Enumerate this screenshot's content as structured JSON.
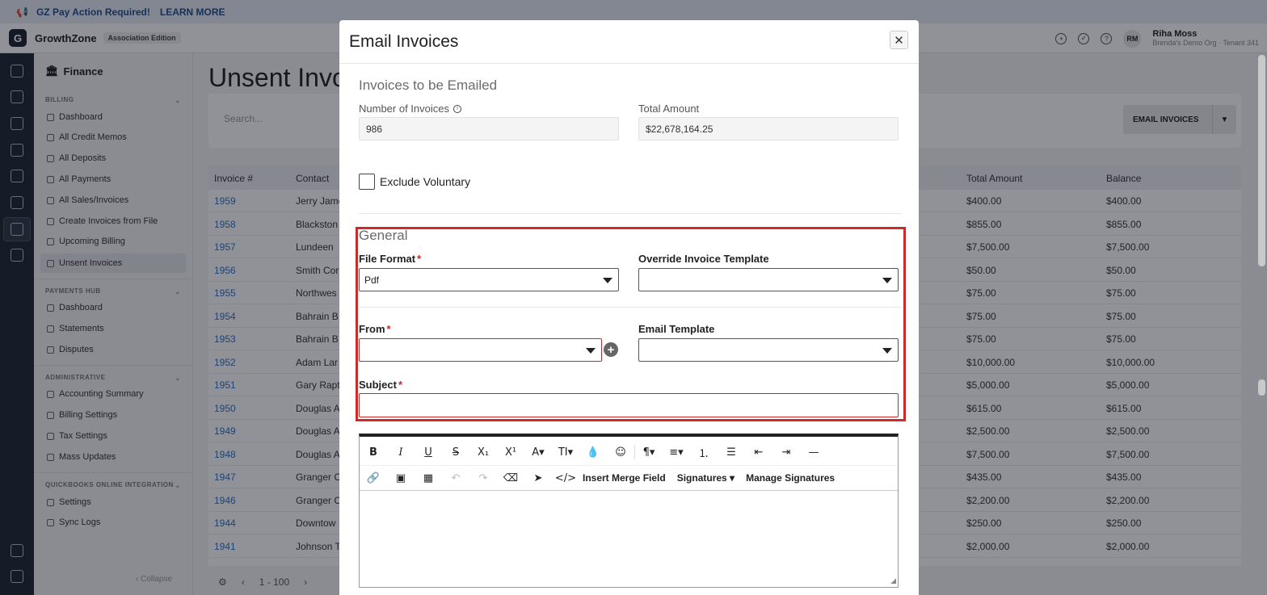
{
  "banner": {
    "message": "GZ Pay Action Required!",
    "link": "LEARN MORE"
  },
  "header": {
    "logo_letter": "G",
    "brand": "GrowthZone",
    "edition": "Association Edition",
    "user_initials": "RM",
    "user_name": "Riha Moss",
    "user_org": "Brenda's Demo Org · Tenant 341"
  },
  "sidebar": {
    "title": "Finance",
    "sections": [
      {
        "label": "BILLING",
        "items": [
          "Dashboard",
          "All Credit Memos",
          "All Deposits",
          "All Payments",
          "All Sales/Invoices",
          "Create Invoices from File",
          "Upcoming Billing",
          "Unsent Invoices"
        ]
      },
      {
        "label": "PAYMENTS HUB",
        "items": [
          "Dashboard",
          "Statements",
          "Disputes"
        ]
      },
      {
        "label": "ADMINISTRATIVE",
        "items": [
          "Accounting Summary",
          "Billing Settings",
          "Tax Settings",
          "Mass Updates"
        ]
      },
      {
        "label": "QUICKBOOKS ONLINE INTEGRATION",
        "items": [
          "Settings",
          "Sync Logs"
        ]
      }
    ],
    "active_item": "Unsent Invoices",
    "collapse": "Collapse"
  },
  "main": {
    "title": "Unsent Invo",
    "search_placeholder": "Search...",
    "email_button": "EMAIL INVOICES",
    "columns": {
      "invoice": "Invoice #",
      "contact": "Contact",
      "total": "Total Amount",
      "balance": "Balance"
    },
    "rows": [
      {
        "inv": "1959",
        "contact": "Jerry Jame",
        "total": "$400.00",
        "balance": "$400.00"
      },
      {
        "inv": "1958",
        "contact": "Blackston",
        "total": "$855.00",
        "balance": "$855.00"
      },
      {
        "inv": "1957",
        "contact": "Lundeen",
        "total": "$7,500.00",
        "balance": "$7,500.00"
      },
      {
        "inv": "1956",
        "contact": "Smith Cor",
        "total": "$50.00",
        "balance": "$50.00"
      },
      {
        "inv": "1955",
        "contact": "Northwes",
        "total": "$75.00",
        "balance": "$75.00"
      },
      {
        "inv": "1954",
        "contact": "Bahrain B",
        "total": "$75.00",
        "balance": "$75.00"
      },
      {
        "inv": "1953",
        "contact": "Bahrain B",
        "total": "$75.00",
        "balance": "$75.00"
      },
      {
        "inv": "1952",
        "contact": "Adam Lar",
        "total": "$10,000.00",
        "balance": "$10,000.00"
      },
      {
        "inv": "1951",
        "contact": "Gary Rapt",
        "total": "$5,000.00",
        "balance": "$5,000.00"
      },
      {
        "inv": "1950",
        "contact": "Douglas A",
        "total": "$615.00",
        "balance": "$615.00"
      },
      {
        "inv": "1949",
        "contact": "Douglas A",
        "total": "$2,500.00",
        "balance": "$2,500.00"
      },
      {
        "inv": "1948",
        "contact": "Douglas A",
        "total": "$7,500.00",
        "balance": "$7,500.00"
      },
      {
        "inv": "1947",
        "contact": "Granger C",
        "total": "$435.00",
        "balance": "$435.00"
      },
      {
        "inv": "1946",
        "contact": "Granger C",
        "total": "$2,200.00",
        "balance": "$2,200.00"
      },
      {
        "inv": "1944",
        "contact": "Downtow",
        "total": "$250.00",
        "balance": "$250.00"
      },
      {
        "inv": "1941",
        "contact": "Johnson T",
        "total": "$2,000.00",
        "balance": "$2,000.00"
      }
    ],
    "pager": "1 - 100"
  },
  "modal": {
    "title": "Email Invoices",
    "section_invoices": "Invoices to be Emailed",
    "num_invoices_label": "Number of Invoices",
    "num_invoices": "986",
    "total_amount_label": "Total Amount",
    "total_amount": "$22,678,164.25",
    "exclude_voluntary": "Exclude Voluntary",
    "section_general": "General",
    "file_format_label": "File Format",
    "file_format_value": "Pdf",
    "override_template_label": "Override Invoice Template",
    "from_label": "From",
    "email_template_label": "Email Template",
    "subject_label": "Subject",
    "required_mark": "*",
    "editor": {
      "insert_merge_field": "Insert Merge Field",
      "signatures": "Signatures",
      "manage_signatures": "Manage Signatures"
    }
  },
  "colors": {
    "accent": "#2f6fc4",
    "error": "#c62828",
    "highlight": "#cf2a2a"
  }
}
